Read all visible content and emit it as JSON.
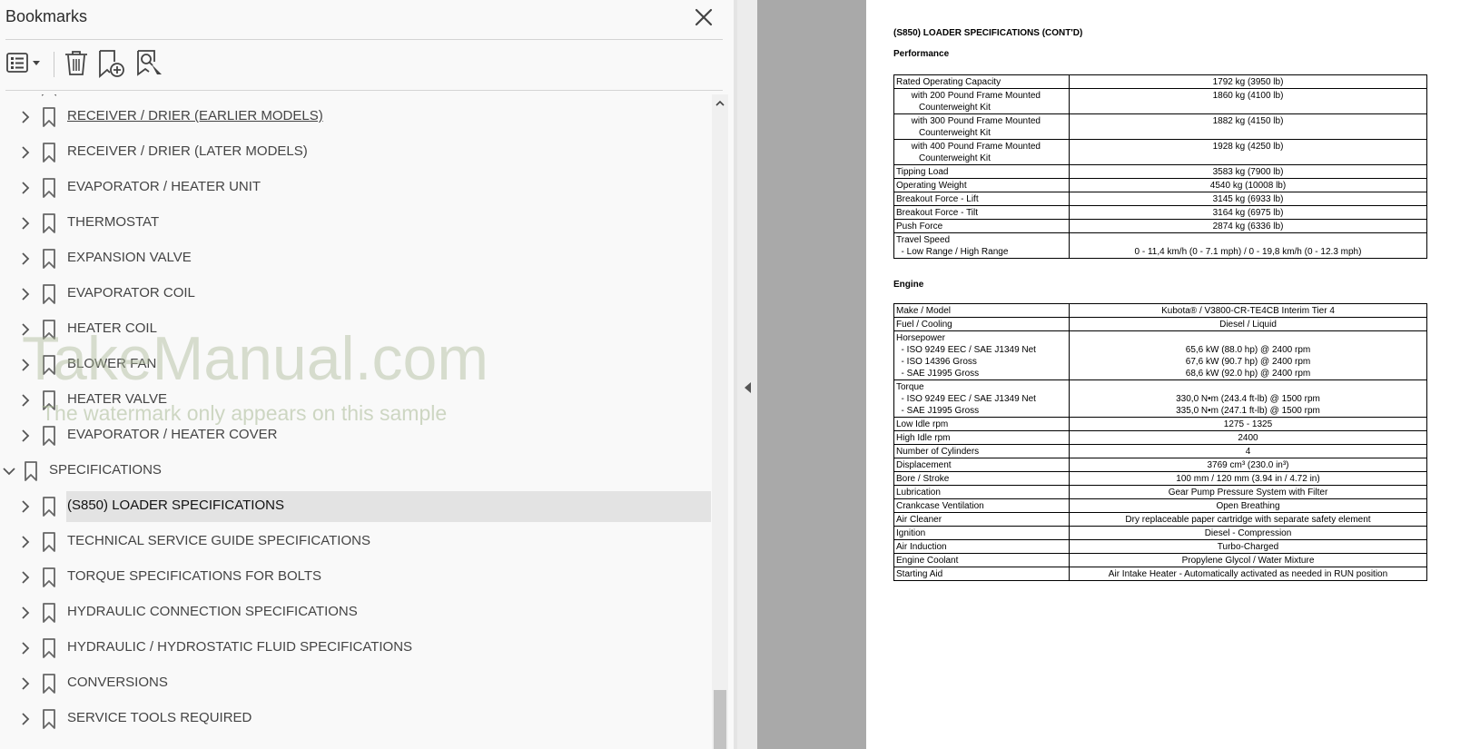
{
  "panel": {
    "title": "Bookmarks",
    "close_icon": "close-icon",
    "toolbar": {
      "options_icon": "list-options-icon",
      "delete_icon": "trash-icon",
      "new_bookmark_icon": "new-bookmark-icon",
      "find_bookmark_icon": "find-current-bookmark-icon"
    }
  },
  "bookmarks": [
    {
      "label": "RECEIVER / DRIER (EARLIER MODELS)",
      "level": 1,
      "expanded": false,
      "linked": true
    },
    {
      "label": "RECEIVER / DRIER (LATER MODELS)",
      "level": 1,
      "expanded": false
    },
    {
      "label": "EVAPORATOR / HEATER UNIT",
      "level": 1,
      "expanded": false
    },
    {
      "label": "THERMOSTAT",
      "level": 1,
      "expanded": false
    },
    {
      "label": "EXPANSION VALVE",
      "level": 1,
      "expanded": false
    },
    {
      "label": "EVAPORATOR COIL",
      "level": 1,
      "expanded": false
    },
    {
      "label": "HEATER COIL",
      "level": 1,
      "expanded": false
    },
    {
      "label": "BLOWER FAN",
      "level": 1,
      "expanded": false
    },
    {
      "label": "HEATER VALVE",
      "level": 1,
      "expanded": false
    },
    {
      "label": "EVAPORATOR / HEATER COVER",
      "level": 1,
      "expanded": false
    },
    {
      "label": "SPECIFICATIONS",
      "level": 0,
      "expanded": true
    },
    {
      "label": "(S850) LOADER SPECIFICATIONS",
      "level": 1,
      "expanded": false,
      "selected": true
    },
    {
      "label": "TECHNICAL SERVICE GUIDE SPECIFICATIONS",
      "level": 1,
      "expanded": false
    },
    {
      "label": "TORQUE SPECIFICATIONS FOR BOLTS",
      "level": 1,
      "expanded": false
    },
    {
      "label": "HYDRAULIC CONNECTION SPECIFICATIONS",
      "level": 1,
      "expanded": false
    },
    {
      "label": "HYDRAULIC / HYDROSTATIC FLUID SPECIFICATIONS",
      "level": 1,
      "expanded": false
    },
    {
      "label": "CONVERSIONS",
      "level": 1,
      "expanded": false
    },
    {
      "label": "SERVICE TOOLS REQUIRED",
      "level": 1,
      "expanded": false
    }
  ],
  "watermark": {
    "main": "TakeManual.com",
    "sub": "The watermark only appears on this sample"
  },
  "document": {
    "heading": "(S850) LOADER SPECIFICATIONS (CONT'D)",
    "performance": {
      "title": "Performance",
      "rows": [
        {
          "k": "Rated Operating Capacity",
          "v": "1792 kg (3950 lb)"
        },
        {
          "k": "      with 200 Pound Frame Mounted\n         Counterweight Kit",
          "v": "1860 kg (4100 lb)"
        },
        {
          "k": "      with 300 Pound Frame Mounted\n         Counterweight Kit",
          "v": "1882 kg (4150 lb)"
        },
        {
          "k": "      with 400 Pound Frame Mounted\n         Counterweight Kit",
          "v": "1928 kg (4250 lb)"
        },
        {
          "k": "Tipping Load",
          "v": "3583 kg (7900 lb)"
        },
        {
          "k": "Operating Weight",
          "v": "4540 kg (10008 lb)"
        },
        {
          "k": "Breakout Force - Lift",
          "v": "3145 kg (6933 lb)"
        },
        {
          "k": "Breakout Force - Tilt",
          "v": "3164 kg (6975 lb)"
        },
        {
          "k": "Push Force",
          "v": "2874 kg (6336 lb)"
        },
        {
          "k": "Travel Speed\n  - Low Range / High Range",
          "v": "\n0 - 11,4 km/h (0 - 7.1 mph) / 0 - 19,8 km/h (0 - 12.3 mph)"
        }
      ]
    },
    "engine": {
      "title": "Engine",
      "rows": [
        {
          "k": "Make / Model",
          "v": "Kubota® / V3800-CR-TE4CB Interim Tier 4"
        },
        {
          "k": "Fuel / Cooling",
          "v": "Diesel / Liquid"
        },
        {
          "k": "Horsepower\n  - ISO 9249 EEC / SAE J1349 Net\n  - ISO 14396 Gross\n  - SAE J1995 Gross",
          "v": "\n65,6 kW (88.0 hp) @ 2400 rpm\n67,6 kW (90.7 hp) @ 2400 rpm\n68,6 kW (92.0 hp) @ 2400 rpm"
        },
        {
          "k": "Torque\n  - ISO 9249 EEC / SAE J1349 Net\n  - SAE J1995 Gross",
          "v": "\n330,0 N•m (243.4 ft-lb) @ 1500 rpm\n335,0 N•m (247.1 ft-lb) @ 1500 rpm"
        },
        {
          "k": "Low Idle rpm",
          "v": "1275 - 1325"
        },
        {
          "k": "High Idle rpm",
          "v": "2400"
        },
        {
          "k": "Number of Cylinders",
          "v": "4"
        },
        {
          "k": "Displacement",
          "v": "3769 cm³ (230.0 in³)"
        },
        {
          "k": "Bore / Stroke",
          "v": "100 mm / 120 mm (3.94 in / 4.72 in)"
        },
        {
          "k": "Lubrication",
          "v": "Gear Pump Pressure System with Filter"
        },
        {
          "k": "Crankcase Ventilation",
          "v": "Open Breathing"
        },
        {
          "k": "Air Cleaner",
          "v": "Dry replaceable paper cartridge with separate safety element"
        },
        {
          "k": "Ignition",
          "v": "Diesel - Compression"
        },
        {
          "k": "Air Induction",
          "v": "Turbo-Charged"
        },
        {
          "k": "Engine Coolant",
          "v": "Propylene Glycol / Water Mixture"
        },
        {
          "k": "Starting Aid",
          "v": "Air Intake Heater - Automatically activated as needed in RUN position"
        }
      ]
    }
  }
}
